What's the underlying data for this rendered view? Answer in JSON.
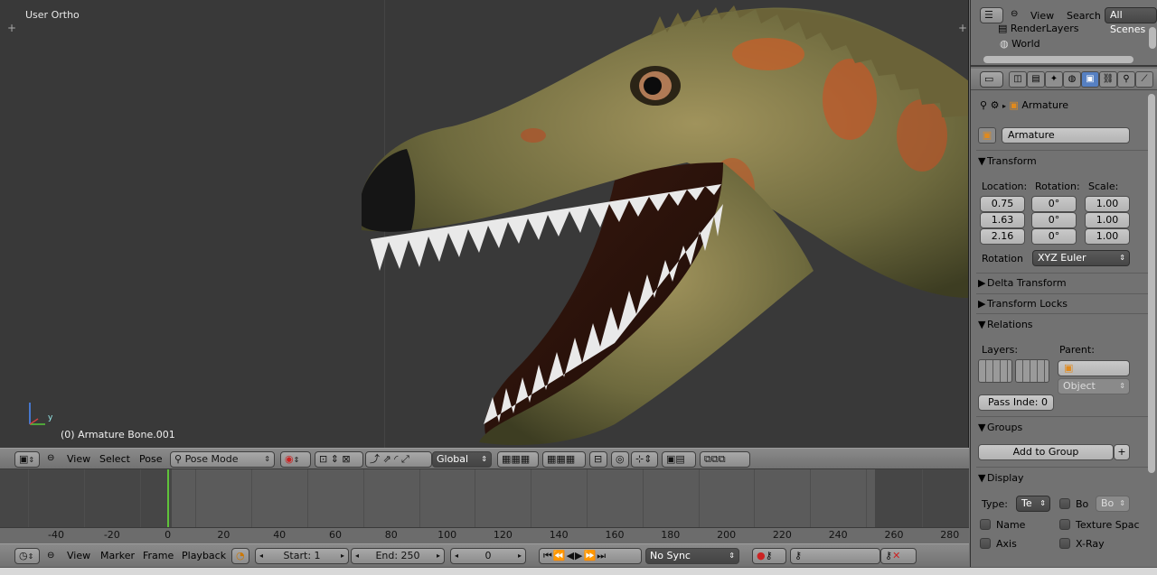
{
  "viewport": {
    "title": "User Ortho",
    "status": "(0) Armature Bone.001",
    "axis_y_label": "y"
  },
  "view3d_header": {
    "menu_view": "View",
    "menu_select": "Select",
    "menu_pose": "Pose",
    "mode": "Pose Mode",
    "orientation": "Global"
  },
  "timeline": {
    "ticks": [
      "-40",
      "-20",
      "0",
      "20",
      "40",
      "60",
      "80",
      "100",
      "120",
      "140",
      "160",
      "180",
      "200",
      "220",
      "240",
      "260",
      "280"
    ],
    "menu_view": "View",
    "menu_marker": "Marker",
    "menu_frame": "Frame",
    "menu_playback": "Playback",
    "start": "Start: 1",
    "end": "End: 250",
    "current": "0",
    "sync": "No Sync",
    "playhead_frame": 0
  },
  "outliner": {
    "menu_view": "View",
    "menu_search": "Search",
    "scene_filter": "All Scenes",
    "items": [
      "RenderLayers",
      "World"
    ]
  },
  "properties": {
    "breadcrumb": "Armature",
    "object_name": "Armature",
    "transform": {
      "title": "Transform",
      "location_label": "Location:",
      "rotation_label": "Rotation:",
      "scale_label": "Scale:",
      "location": [
        "0.75",
        "1.63",
        "2.16"
      ],
      "rotation": [
        "0°",
        "0°",
        "0°"
      ],
      "scale": [
        "1.00",
        "1.00",
        "1.00"
      ],
      "rotation_mode_label": "Rotation",
      "rotation_mode": "XYZ Euler"
    },
    "delta_transform": "Delta Transform",
    "transform_locks": "Transform Locks",
    "relations": {
      "title": "Relations",
      "layers_label": "Layers:",
      "parent_label": "Parent:",
      "parent_type": "Object",
      "pass_index": "Pass Inde: 0"
    },
    "groups": {
      "title": "Groups",
      "add_to_group": "Add to Group"
    },
    "display": {
      "title": "Display",
      "type_label": "Type:",
      "type_value": "Te",
      "bounds_label": "Bo",
      "bounds_value": "Bo",
      "name": "Name",
      "texture_space": "Texture Spac",
      "axis": "Axis",
      "xray": "X-Ray"
    }
  },
  "colors": {
    "viewport_bg": "#393939",
    "panel_bg": "#727272",
    "playhead": "#5fc23a",
    "timeline_bg": "#5b5b5b"
  }
}
